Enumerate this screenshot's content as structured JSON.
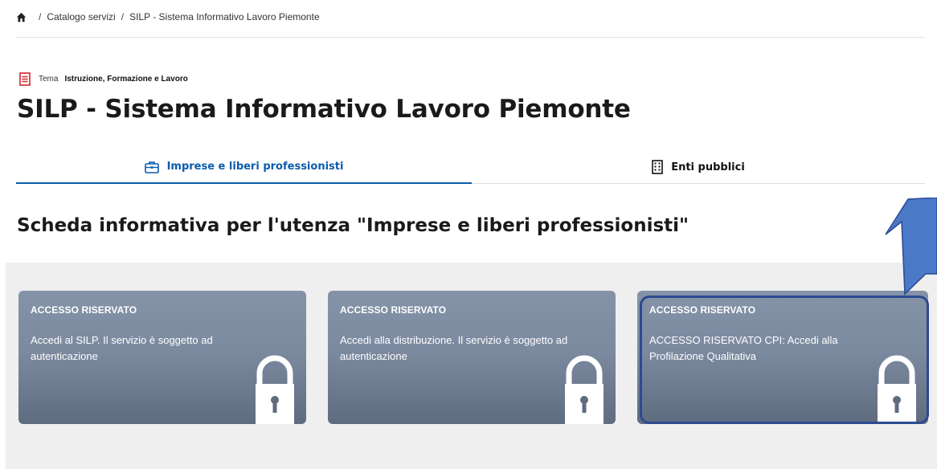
{
  "breadcrumb": {
    "sep": "/",
    "item1": "Catalogo servizi",
    "item2": "SILP - Sistema Informativo Lavoro Piemonte"
  },
  "topic": {
    "label": "Tema",
    "value": "Istruzione, Formazione e Lavoro"
  },
  "page_title": "SILP - Sistema Informativo Lavoro Piemonte",
  "tabs": [
    {
      "label": "Imprese e liberi professionisti",
      "active": true
    },
    {
      "label": "Enti pubblici",
      "active": false
    }
  ],
  "section_title": "Scheda informativa per l'utenza \"Imprese e liberi professionisti\"",
  "cards": [
    {
      "heading": "ACCESSO RISERVATO",
      "description": "Accedi al SILP. Il servizio è soggetto ad autenticazione"
    },
    {
      "heading": "ACCESSO RISERVATO",
      "description": "Accedi alla distribuzione. Il servizio è soggetto ad autenticazione"
    },
    {
      "heading": "ACCESSO RISERVATO",
      "description": "ACCESSO RISERVATO CPI: Accedi alla Profilazione Qualitativa"
    }
  ],
  "colors": {
    "accent": "#0b5cad",
    "card": "#7c8aa0",
    "highlight": "#2c4a91",
    "arrow": "#4a79c8"
  }
}
